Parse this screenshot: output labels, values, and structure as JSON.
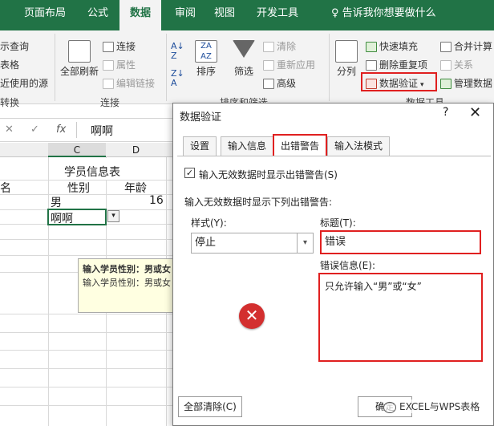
{
  "colors": {
    "ribbon_green": "#217346",
    "highlight": "#e02020",
    "stop": "#d32f2f"
  },
  "ribbon_tabs": [
    {
      "label": "页面布局"
    },
    {
      "label": "公式"
    },
    {
      "label": "数据"
    },
    {
      "label": "审阅"
    },
    {
      "label": "视图"
    },
    {
      "label": "开发工具"
    }
  ],
  "tell_me": "♀ 告诉我你想要做什么",
  "ribbon": {
    "left_items": [
      "示查询",
      "表格",
      "近使用的源"
    ],
    "left_group": "转换",
    "refresh_all": "全部刷新",
    "connections": "连接",
    "properties": "属性",
    "edit_links": "编辑链接",
    "connections_group": "连接",
    "sort": "排序",
    "filter": "筛选",
    "clear": "清除",
    "reapply": "重新应用",
    "advanced": "高级",
    "sort_group": "排序和筛选",
    "text_to_columns": "分列",
    "flash_fill": "快速填充",
    "remove_duplicates": "删除重复项",
    "data_validation": "数据验证",
    "data_tools_group": "数据工具",
    "consolidate": "合并计算",
    "relationships": "关系",
    "manage_model": "管理数据"
  },
  "formula_bar": {
    "cancel": "✕",
    "enter": "✓",
    "fx": "fx",
    "value": "啊啊"
  },
  "sheet": {
    "col_c": "C",
    "col_d": "D",
    "title": "学员信息表",
    "header_left": "名",
    "header_gender": "性别",
    "header_age": "年龄",
    "row1_gender": "男",
    "row1_age": "16",
    "row2_gender": "啊啊"
  },
  "tooltip": {
    "title": "输入学员性别：男或女",
    "body": "输入学员性别：男或女"
  },
  "dialog": {
    "title": "数据验证",
    "help": "?",
    "close": "✕",
    "tabs": [
      {
        "label": "设置"
      },
      {
        "label": "输入信息"
      },
      {
        "label": "出错警告"
      },
      {
        "label": "输入法模式"
      }
    ],
    "show_error_label": "输入无效数据时显示出错警告(S)",
    "show_error_checked": "✓",
    "section_label": "输入无效数据时显示下列出错警告:",
    "style_label": "样式(Y):",
    "style_value": "停止",
    "style_arrow": "▾",
    "title_label": "标题(T):",
    "title_value": "错误",
    "message_label": "错误信息(E):",
    "message_value": "只允许输入“男”或“女”",
    "stop_glyph": "✕",
    "clear_button": "全部清除(C)",
    "ok_button": "确定"
  },
  "watermark": "EXCEL与WPS表格"
}
